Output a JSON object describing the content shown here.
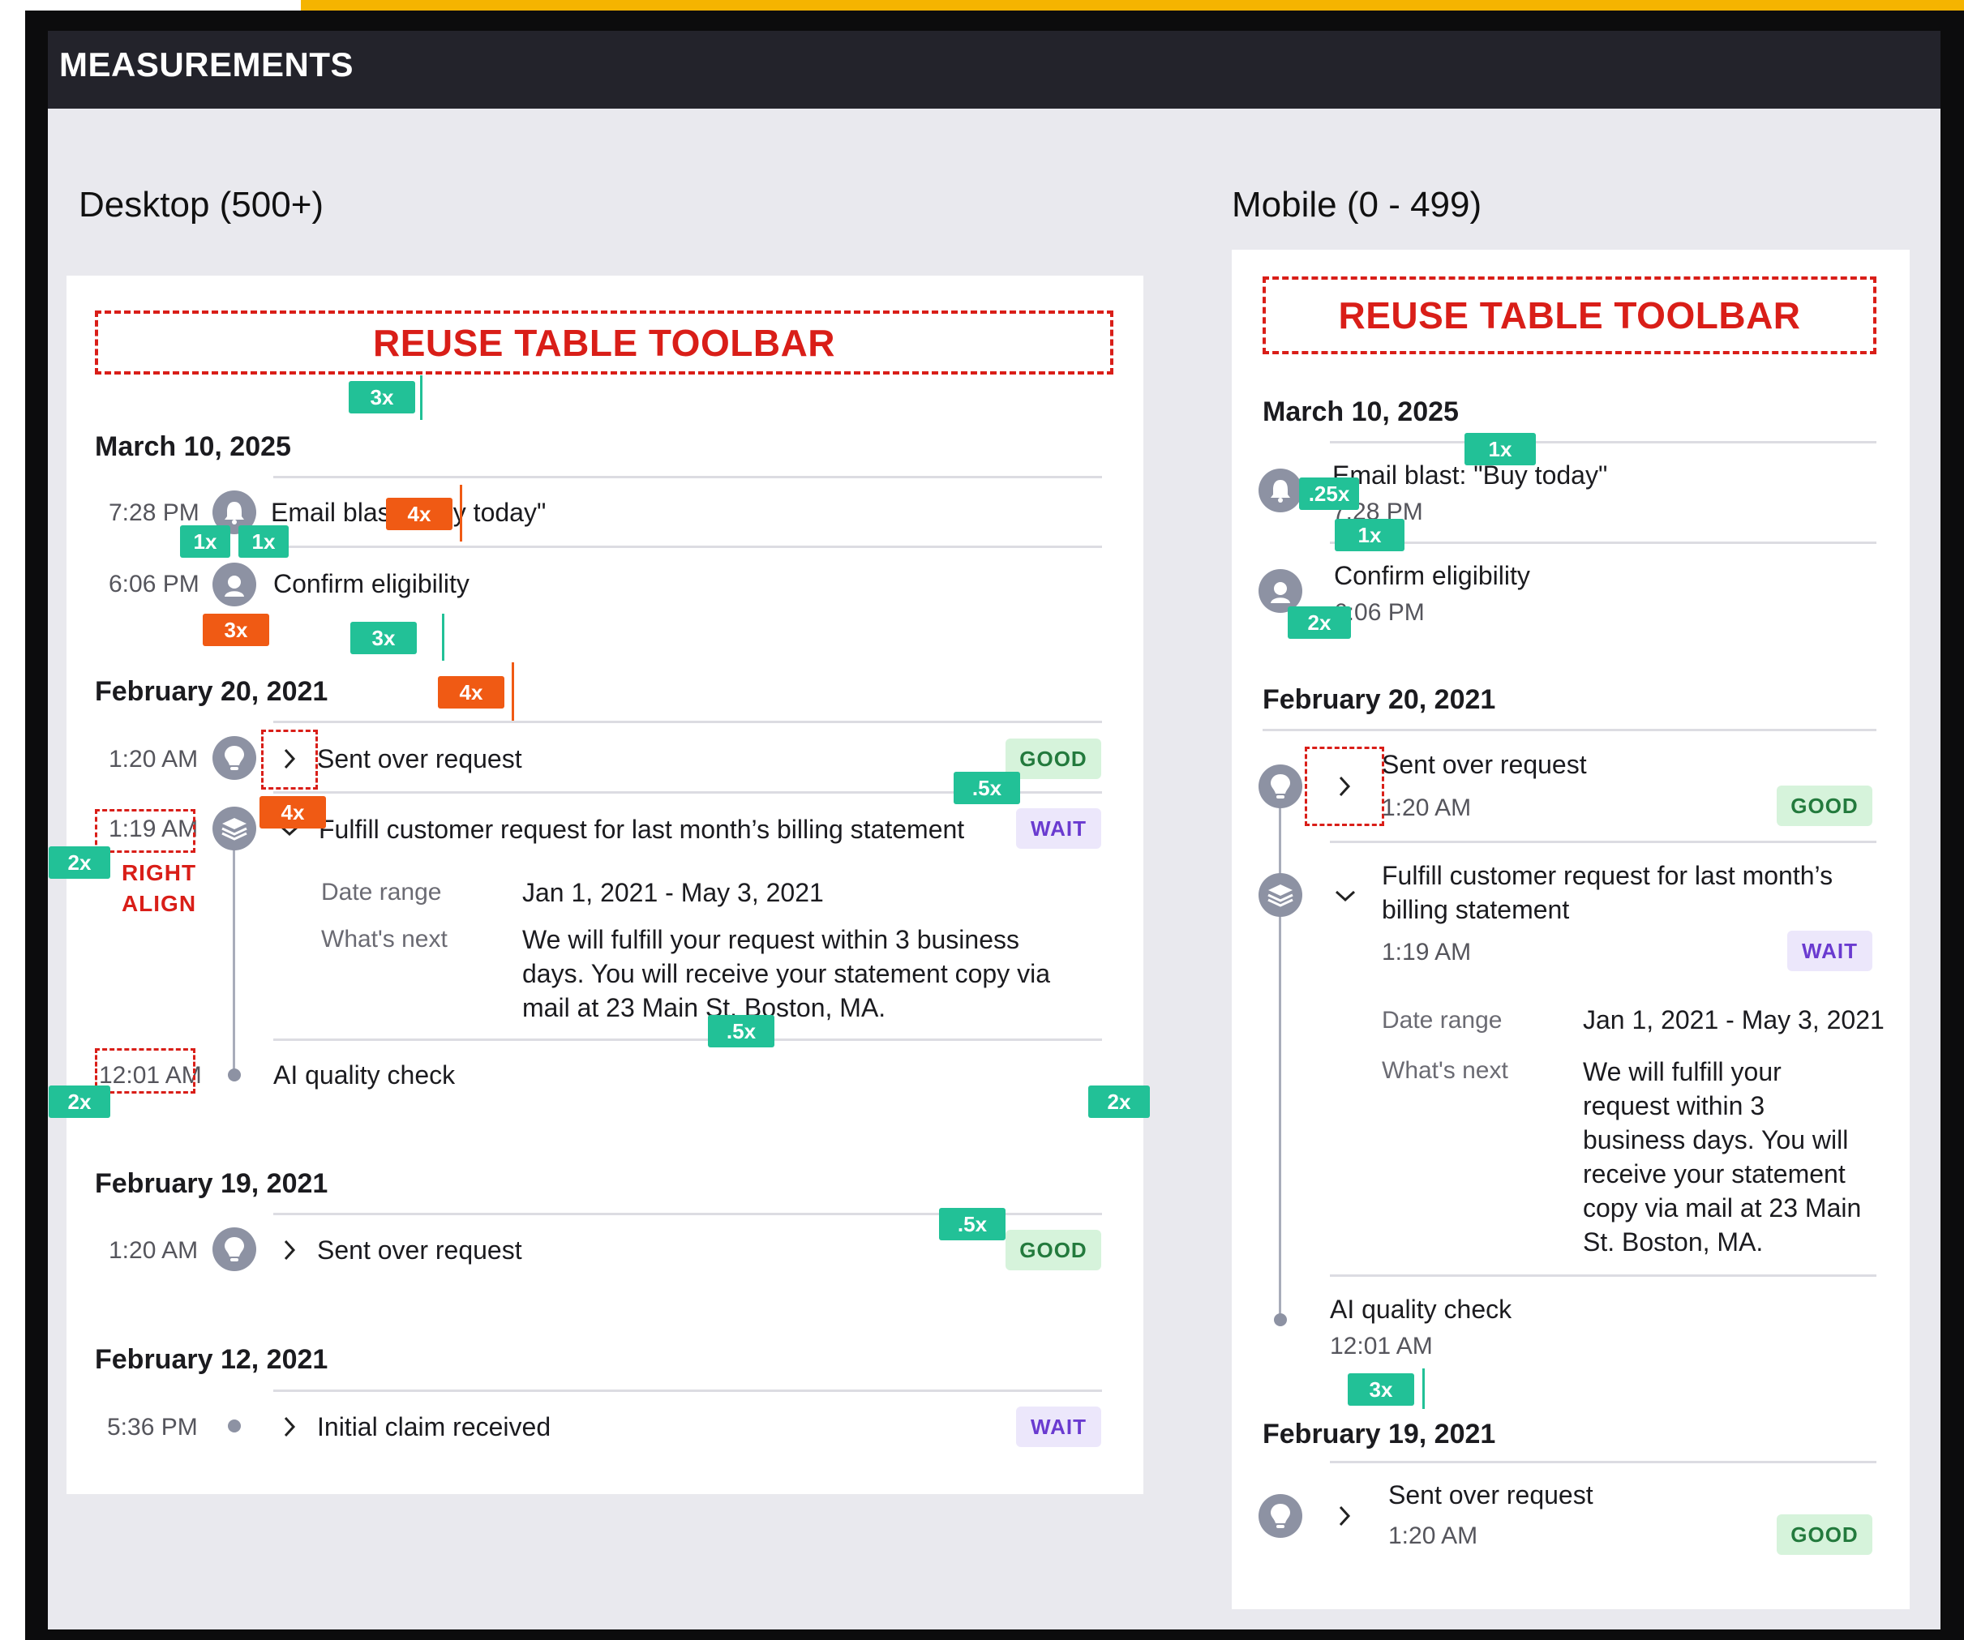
{
  "title": "MEASUREMENTS",
  "colors": {
    "accent": "#f5b400",
    "toolbar_red": "#d91e18",
    "measure_teal": "#22c197",
    "measure_orange": "#f05a14"
  },
  "desktop": {
    "title": "Desktop (500+)",
    "toolbar": "REUSE TABLE TOOLBAR",
    "groups": [
      {
        "date": "March 10, 2025",
        "items": [
          {
            "time": "7:28 PM",
            "text": "Email blast: \"Buy today\"",
            "icon": "bell-icon"
          },
          {
            "time": "6:06 PM",
            "text": "Confirm eligibility",
            "icon": "user-icon"
          }
        ]
      },
      {
        "date": "February 20, 2021",
        "items": [
          {
            "time": "1:20 AM",
            "text": "Sent over request",
            "icon": "lightbulb-icon",
            "badge": "GOOD"
          },
          {
            "time": "1:19 AM",
            "text": "Fulfill customer request for last month’s billing statement",
            "icon": "layers-icon",
            "badge": "WAIT",
            "details": {
              "date_range_label": "Date range",
              "date_range_value": "Jan 1, 2021 - May 3, 2021",
              "next_label": "What's next",
              "next_lines": [
                "We will fulfill your request within 3 business",
                "days. You will receive your statement copy via",
                "mail at 23 Main St. Boston, MA."
              ]
            }
          },
          {
            "time": "12:01 AM",
            "text": "AI quality check",
            "icon": "dot"
          }
        ]
      },
      {
        "date": "February 19, 2021",
        "items": [
          {
            "time": "1:20 AM",
            "text": "Sent over request",
            "icon": "lightbulb-icon",
            "badge": "GOOD"
          }
        ]
      },
      {
        "date": "February 12, 2021",
        "items": [
          {
            "time": "5:36 PM",
            "text": "Initial claim received",
            "icon": "dot",
            "badge": "WAIT"
          }
        ]
      }
    ],
    "right_align_note": [
      "RIGHT",
      "ALIGN"
    ]
  },
  "mobile": {
    "title": "Mobile (0 - 499)",
    "toolbar": "REUSE TABLE TOOLBAR",
    "groups": [
      {
        "date": "March 10, 2025",
        "items": [
          {
            "text": "Email blast: \"Buy today\"",
            "time": "7:28 PM"
          },
          {
            "text": "Confirm eligibility",
            "time": "6:06 PM"
          }
        ]
      },
      {
        "date": "February 20, 2021",
        "items": [
          {
            "text": "Sent over request",
            "time": "1:20 AM",
            "badge": "GOOD"
          },
          {
            "lines": [
              "Fulfill customer request for last month’s",
              "billing statement"
            ],
            "time": "1:19 AM",
            "badge": "WAIT",
            "details": {
              "date_range_label": "Date range",
              "date_range_value": "Jan 1, 2021 - May 3, 2021",
              "next_label": "What's next",
              "next_lines": [
                "We will fulfill your",
                "request within 3",
                "business days. You will",
                "receive your statement",
                "copy via mail at 23 Main",
                "St. Boston, MA."
              ]
            }
          },
          {
            "text": "AI quality check",
            "time": "12:01 AM"
          }
        ]
      },
      {
        "date": "February 19, 2021",
        "items": [
          {
            "text": "Sent over request",
            "time": "1:20 AM",
            "badge": "GOOD"
          }
        ]
      }
    ]
  },
  "measure_labels": [
    "3x",
    "1x",
    "1x",
    "4x",
    "3x",
    "3x",
    "4x",
    "4x",
    ".5x",
    "2x",
    ".5x",
    "2x",
    "2x",
    ".5x",
    "1x",
    ".25x",
    "1x",
    "2x",
    "3x"
  ]
}
